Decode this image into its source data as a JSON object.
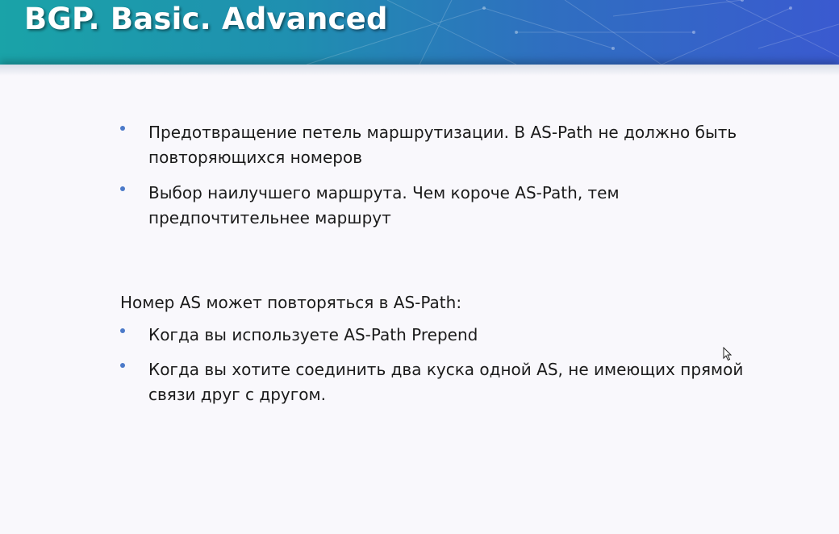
{
  "slide": {
    "title": "BGP. Basic. Advanced",
    "bullets_top": [
      "Предотвращение петель маршрутизации. В AS-Path не должно быть повторяющихся номеров",
      "Выбор наилучшего маршрута. Чем короче AS-Path, тем предпочтительнее маршрут"
    ],
    "section_heading": "Номер AS может повторяться в AS-Path:",
    "bullets_bottom": [
      "Когда вы используете AS-Path Prepend",
      "Когда вы хотите соединить два куска одной AS, не имеющих прямой связи друг с другом."
    ]
  },
  "colors": {
    "header_gradient_start": "#1aa3a8",
    "header_gradient_end": "#3a5ad0",
    "bullet_dot": "#4c7ac9",
    "text": "#1b1b1b",
    "background": "#f9f8fc"
  },
  "icons": {
    "bullet": "dot-bullet",
    "pointer": "mouse-pointer-icon"
  }
}
